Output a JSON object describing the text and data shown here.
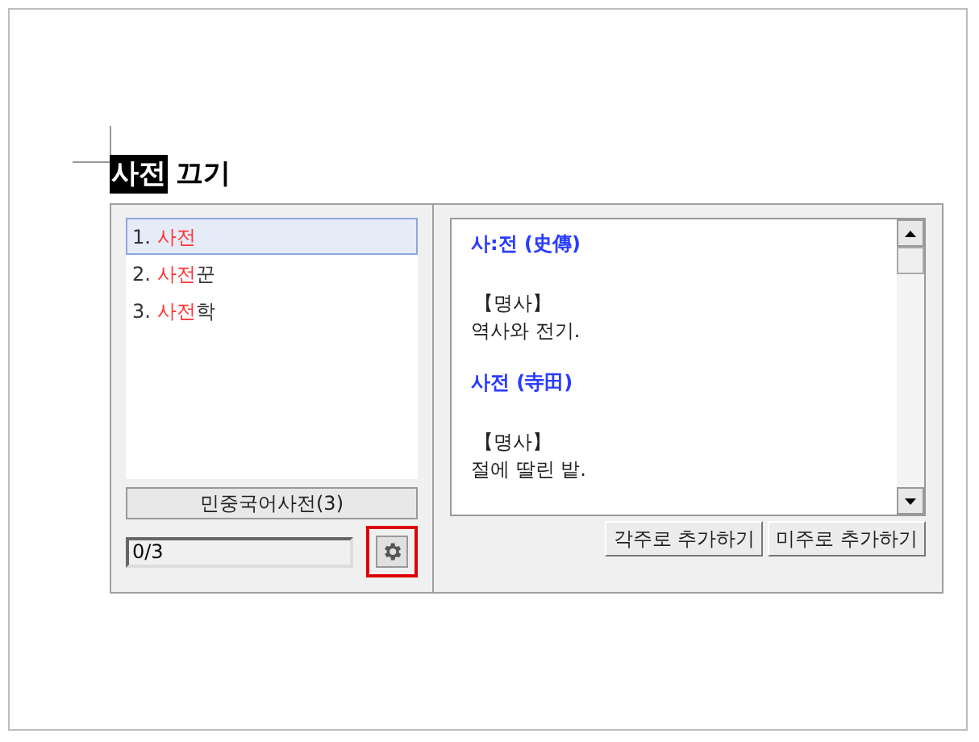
{
  "document": {
    "highlighted_word": "사전",
    "next_word": "끄기"
  },
  "results": {
    "items": [
      {
        "number": "1.",
        "match": "사전",
        "selected": true
      },
      {
        "number": "2.",
        "match": "사전",
        "rest": "꾼",
        "selected": false
      },
      {
        "number": "3.",
        "match": "사전",
        "rest": "학",
        "selected": false
      }
    ],
    "dictionary_label": "민중국어사전(3)",
    "counter": "0/3"
  },
  "definition": {
    "entries": [
      {
        "headword": "사:전 (史傳)",
        "pos": "【명사】",
        "meaning": "역사와 전기."
      },
      {
        "headword": "사전 (寺田)",
        "pos": "【명사】",
        "meaning": "절에 딸린 밭."
      }
    ],
    "buttons": [
      "각주로 추가하기",
      "미주로 추가하기"
    ]
  }
}
